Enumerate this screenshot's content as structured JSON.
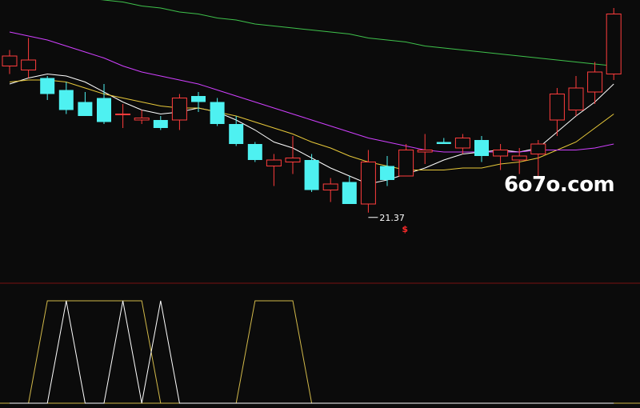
{
  "chart_data": {
    "type": "candlestick",
    "price_axis": [
      18.0,
      32.0
    ],
    "low_annotation": {
      "index": 19,
      "label": "21.37",
      "marker": "$"
    },
    "candles": [
      {
        "open": 28.7,
        "high": 29.5,
        "low": 28.3,
        "close": 29.2
      },
      {
        "open": 28.5,
        "high": 30.1,
        "low": 28.1,
        "close": 29.0
      },
      {
        "open": 28.1,
        "high": 28.2,
        "low": 27.0,
        "close": 27.3
      },
      {
        "open": 27.5,
        "high": 27.9,
        "low": 26.3,
        "close": 26.5
      },
      {
        "open": 26.9,
        "high": 27.4,
        "low": 26.7,
        "close": 26.2
      },
      {
        "open": 27.1,
        "high": 27.8,
        "low": 25.8,
        "close": 25.9
      },
      {
        "open": 26.3,
        "high": 26.8,
        "low": 25.6,
        "close": 26.3
      },
      {
        "open": 26.0,
        "high": 26.5,
        "low": 25.8,
        "close": 26.1
      },
      {
        "open": 26.0,
        "high": 26.2,
        "low": 25.5,
        "close": 25.6
      },
      {
        "open": 26.0,
        "high": 27.3,
        "low": 25.5,
        "close": 27.1
      },
      {
        "open": 27.2,
        "high": 27.4,
        "low": 26.4,
        "close": 26.9
      },
      {
        "open": 26.9,
        "high": 27.1,
        "low": 25.7,
        "close": 25.8
      },
      {
        "open": 25.8,
        "high": 26.2,
        "low": 24.7,
        "close": 24.8
      },
      {
        "open": 24.8,
        "high": 24.9,
        "low": 23.9,
        "close": 24.0
      },
      {
        "open": 23.7,
        "high": 24.3,
        "low": 22.7,
        "close": 24.0
      },
      {
        "open": 23.9,
        "high": 25.2,
        "low": 23.3,
        "close": 24.1
      },
      {
        "open": 24.0,
        "high": 24.3,
        "low": 22.4,
        "close": 22.5
      },
      {
        "open": 22.5,
        "high": 23.1,
        "low": 21.9,
        "close": 22.8
      },
      {
        "open": 22.9,
        "high": 23.2,
        "low": 21.8,
        "close": 21.8
      },
      {
        "open": 21.8,
        "high": 24.5,
        "low": 21.37,
        "close": 23.9
      },
      {
        "open": 23.7,
        "high": 24.2,
        "low": 22.7,
        "close": 23.0
      },
      {
        "open": 23.2,
        "high": 24.8,
        "low": 23.2,
        "close": 24.5
      },
      {
        "open": 24.4,
        "high": 25.3,
        "low": 23.8,
        "close": 24.5
      },
      {
        "open": 24.9,
        "high": 25.1,
        "low": 24.8,
        "close": 24.8
      },
      {
        "open": 24.6,
        "high": 25.3,
        "low": 24.3,
        "close": 25.1
      },
      {
        "open": 25.0,
        "high": 25.2,
        "low": 23.9,
        "close": 24.2
      },
      {
        "open": 24.2,
        "high": 24.8,
        "low": 23.5,
        "close": 24.5
      },
      {
        "open": 24.0,
        "high": 24.6,
        "low": 23.3,
        "close": 24.2
      },
      {
        "open": 24.3,
        "high": 25.0,
        "low": 23.2,
        "close": 24.8
      },
      {
        "open": 26.0,
        "high": 27.6,
        "low": 25.2,
        "close": 27.3
      },
      {
        "open": 26.5,
        "high": 28.2,
        "low": 26.2,
        "close": 27.6
      },
      {
        "open": 27.4,
        "high": 28.9,
        "low": 26.8,
        "close": 28.4
      },
      {
        "open": 28.3,
        "high": 31.6,
        "low": 28.0,
        "close": 31.3
      }
    ],
    "moving_averages": [
      {
        "color": "#ffffff",
        "values": [
          27.8,
          28.1,
          28.3,
          28.2,
          27.9,
          27.4,
          26.9,
          26.5,
          26.3,
          26.4,
          26.6,
          26.4,
          26.0,
          25.5,
          24.9,
          24.6,
          24.1,
          23.6,
          23.2,
          22.8,
          23.0,
          23.3,
          23.6,
          24.0,
          24.3,
          24.4,
          24.5,
          24.4,
          24.6,
          25.4,
          26.2,
          26.9,
          27.8
        ]
      },
      {
        "color": "#e8c93a",
        "values": [
          27.9,
          28.0,
          28.0,
          27.9,
          27.6,
          27.3,
          27.1,
          26.9,
          26.7,
          26.6,
          26.6,
          26.4,
          26.2,
          25.9,
          25.6,
          25.3,
          24.9,
          24.6,
          24.2,
          23.9,
          23.7,
          23.5,
          23.5,
          23.5,
          23.6,
          23.6,
          23.8,
          23.9,
          24.1,
          24.5,
          24.9,
          25.6,
          26.3
        ]
      },
      {
        "color": "#d040ff",
        "values": [
          30.4,
          30.2,
          30.0,
          29.7,
          29.4,
          29.1,
          28.7,
          28.4,
          28.2,
          28.0,
          27.8,
          27.5,
          27.2,
          26.9,
          26.6,
          26.3,
          26.0,
          25.7,
          25.4,
          25.1,
          24.9,
          24.7,
          24.5,
          24.4,
          24.4,
          24.4,
          24.4,
          24.4,
          24.5,
          24.5,
          24.5,
          24.6,
          24.8
        ]
      },
      {
        "color": "#3fc24c",
        "values": [
          32.6,
          32.5,
          32.4,
          32.3,
          32.1,
          32.0,
          31.9,
          31.7,
          31.6,
          31.4,
          31.3,
          31.1,
          31.0,
          30.8,
          30.7,
          30.6,
          30.5,
          30.4,
          30.3,
          30.1,
          30.0,
          29.9,
          29.7,
          29.6,
          29.5,
          29.4,
          29.3,
          29.2,
          29.1,
          29.0,
          28.9,
          28.8,
          28.7
        ]
      }
    ],
    "indicator": {
      "range": [
        0,
        1
      ],
      "baseline_color": "#d2b94a",
      "yellow": [
        0,
        0,
        1,
        1,
        1,
        1,
        1,
        1,
        0,
        0,
        0,
        0,
        0,
        1,
        1,
        1,
        0,
        0,
        0,
        0,
        0,
        0,
        0,
        0,
        0,
        0,
        0,
        0,
        0,
        0,
        0,
        0,
        0
      ],
      "white": [
        0,
        0,
        0,
        1,
        0,
        0,
        1,
        0,
        1,
        0,
        0,
        0,
        0,
        0,
        0,
        0,
        0,
        0,
        0,
        0,
        0,
        0,
        0,
        0,
        0,
        0,
        0,
        0,
        0,
        0,
        0,
        0,
        0
      ],
      "yellow_color": "#d2b94a",
      "white_color": "#ffffff"
    },
    "colors": {
      "up": "#ff3c3c",
      "down": "#4ef1f1",
      "separator": "#7a1010",
      "background": "#0b0b0b"
    }
  },
  "watermark": "6o7o.com"
}
